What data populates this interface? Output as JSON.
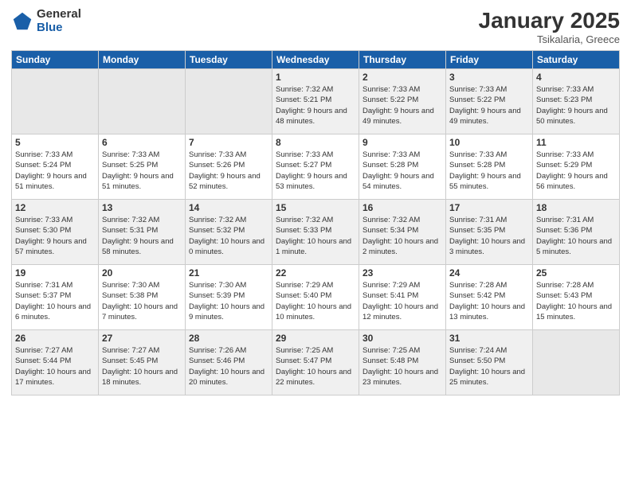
{
  "logo": {
    "general": "General",
    "blue": "Blue"
  },
  "header": {
    "month": "January 2025",
    "location": "Tsikalaria, Greece"
  },
  "weekdays": [
    "Sunday",
    "Monday",
    "Tuesday",
    "Wednesday",
    "Thursday",
    "Friday",
    "Saturday"
  ],
  "weeks": [
    [
      {
        "day": "",
        "sunrise": "",
        "sunset": "",
        "daylight": "",
        "empty": true
      },
      {
        "day": "",
        "sunrise": "",
        "sunset": "",
        "daylight": "",
        "empty": true
      },
      {
        "day": "",
        "sunrise": "",
        "sunset": "",
        "daylight": "",
        "empty": true
      },
      {
        "day": "1",
        "sunrise": "Sunrise: 7:32 AM",
        "sunset": "Sunset: 5:21 PM",
        "daylight": "Daylight: 9 hours and 48 minutes.",
        "empty": false
      },
      {
        "day": "2",
        "sunrise": "Sunrise: 7:33 AM",
        "sunset": "Sunset: 5:22 PM",
        "daylight": "Daylight: 9 hours and 49 minutes.",
        "empty": false
      },
      {
        "day": "3",
        "sunrise": "Sunrise: 7:33 AM",
        "sunset": "Sunset: 5:22 PM",
        "daylight": "Daylight: 9 hours and 49 minutes.",
        "empty": false
      },
      {
        "day": "4",
        "sunrise": "Sunrise: 7:33 AM",
        "sunset": "Sunset: 5:23 PM",
        "daylight": "Daylight: 9 hours and 50 minutes.",
        "empty": false
      }
    ],
    [
      {
        "day": "5",
        "sunrise": "Sunrise: 7:33 AM",
        "sunset": "Sunset: 5:24 PM",
        "daylight": "Daylight: 9 hours and 51 minutes.",
        "empty": false
      },
      {
        "day": "6",
        "sunrise": "Sunrise: 7:33 AM",
        "sunset": "Sunset: 5:25 PM",
        "daylight": "Daylight: 9 hours and 51 minutes.",
        "empty": false
      },
      {
        "day": "7",
        "sunrise": "Sunrise: 7:33 AM",
        "sunset": "Sunset: 5:26 PM",
        "daylight": "Daylight: 9 hours and 52 minutes.",
        "empty": false
      },
      {
        "day": "8",
        "sunrise": "Sunrise: 7:33 AM",
        "sunset": "Sunset: 5:27 PM",
        "daylight": "Daylight: 9 hours and 53 minutes.",
        "empty": false
      },
      {
        "day": "9",
        "sunrise": "Sunrise: 7:33 AM",
        "sunset": "Sunset: 5:28 PM",
        "daylight": "Daylight: 9 hours and 54 minutes.",
        "empty": false
      },
      {
        "day": "10",
        "sunrise": "Sunrise: 7:33 AM",
        "sunset": "Sunset: 5:28 PM",
        "daylight": "Daylight: 9 hours and 55 minutes.",
        "empty": false
      },
      {
        "day": "11",
        "sunrise": "Sunrise: 7:33 AM",
        "sunset": "Sunset: 5:29 PM",
        "daylight": "Daylight: 9 hours and 56 minutes.",
        "empty": false
      }
    ],
    [
      {
        "day": "12",
        "sunrise": "Sunrise: 7:33 AM",
        "sunset": "Sunset: 5:30 PM",
        "daylight": "Daylight: 9 hours and 57 minutes.",
        "empty": false
      },
      {
        "day": "13",
        "sunrise": "Sunrise: 7:32 AM",
        "sunset": "Sunset: 5:31 PM",
        "daylight": "Daylight: 9 hours and 58 minutes.",
        "empty": false
      },
      {
        "day": "14",
        "sunrise": "Sunrise: 7:32 AM",
        "sunset": "Sunset: 5:32 PM",
        "daylight": "Daylight: 10 hours and 0 minutes.",
        "empty": false
      },
      {
        "day": "15",
        "sunrise": "Sunrise: 7:32 AM",
        "sunset": "Sunset: 5:33 PM",
        "daylight": "Daylight: 10 hours and 1 minute.",
        "empty": false
      },
      {
        "day": "16",
        "sunrise": "Sunrise: 7:32 AM",
        "sunset": "Sunset: 5:34 PM",
        "daylight": "Daylight: 10 hours and 2 minutes.",
        "empty": false
      },
      {
        "day": "17",
        "sunrise": "Sunrise: 7:31 AM",
        "sunset": "Sunset: 5:35 PM",
        "daylight": "Daylight: 10 hours and 3 minutes.",
        "empty": false
      },
      {
        "day": "18",
        "sunrise": "Sunrise: 7:31 AM",
        "sunset": "Sunset: 5:36 PM",
        "daylight": "Daylight: 10 hours and 5 minutes.",
        "empty": false
      }
    ],
    [
      {
        "day": "19",
        "sunrise": "Sunrise: 7:31 AM",
        "sunset": "Sunset: 5:37 PM",
        "daylight": "Daylight: 10 hours and 6 minutes.",
        "empty": false
      },
      {
        "day": "20",
        "sunrise": "Sunrise: 7:30 AM",
        "sunset": "Sunset: 5:38 PM",
        "daylight": "Daylight: 10 hours and 7 minutes.",
        "empty": false
      },
      {
        "day": "21",
        "sunrise": "Sunrise: 7:30 AM",
        "sunset": "Sunset: 5:39 PM",
        "daylight": "Daylight: 10 hours and 9 minutes.",
        "empty": false
      },
      {
        "day": "22",
        "sunrise": "Sunrise: 7:29 AM",
        "sunset": "Sunset: 5:40 PM",
        "daylight": "Daylight: 10 hours and 10 minutes.",
        "empty": false
      },
      {
        "day": "23",
        "sunrise": "Sunrise: 7:29 AM",
        "sunset": "Sunset: 5:41 PM",
        "daylight": "Daylight: 10 hours and 12 minutes.",
        "empty": false
      },
      {
        "day": "24",
        "sunrise": "Sunrise: 7:28 AM",
        "sunset": "Sunset: 5:42 PM",
        "daylight": "Daylight: 10 hours and 13 minutes.",
        "empty": false
      },
      {
        "day": "25",
        "sunrise": "Sunrise: 7:28 AM",
        "sunset": "Sunset: 5:43 PM",
        "daylight": "Daylight: 10 hours and 15 minutes.",
        "empty": false
      }
    ],
    [
      {
        "day": "26",
        "sunrise": "Sunrise: 7:27 AM",
        "sunset": "Sunset: 5:44 PM",
        "daylight": "Daylight: 10 hours and 17 minutes.",
        "empty": false
      },
      {
        "day": "27",
        "sunrise": "Sunrise: 7:27 AM",
        "sunset": "Sunset: 5:45 PM",
        "daylight": "Daylight: 10 hours and 18 minutes.",
        "empty": false
      },
      {
        "day": "28",
        "sunrise": "Sunrise: 7:26 AM",
        "sunset": "Sunset: 5:46 PM",
        "daylight": "Daylight: 10 hours and 20 minutes.",
        "empty": false
      },
      {
        "day": "29",
        "sunrise": "Sunrise: 7:25 AM",
        "sunset": "Sunset: 5:47 PM",
        "daylight": "Daylight: 10 hours and 22 minutes.",
        "empty": false
      },
      {
        "day": "30",
        "sunrise": "Sunrise: 7:25 AM",
        "sunset": "Sunset: 5:48 PM",
        "daylight": "Daylight: 10 hours and 23 minutes.",
        "empty": false
      },
      {
        "day": "31",
        "sunrise": "Sunrise: 7:24 AM",
        "sunset": "Sunset: 5:50 PM",
        "daylight": "Daylight: 10 hours and 25 minutes.",
        "empty": false
      },
      {
        "day": "",
        "sunrise": "",
        "sunset": "",
        "daylight": "",
        "empty": true
      }
    ]
  ]
}
